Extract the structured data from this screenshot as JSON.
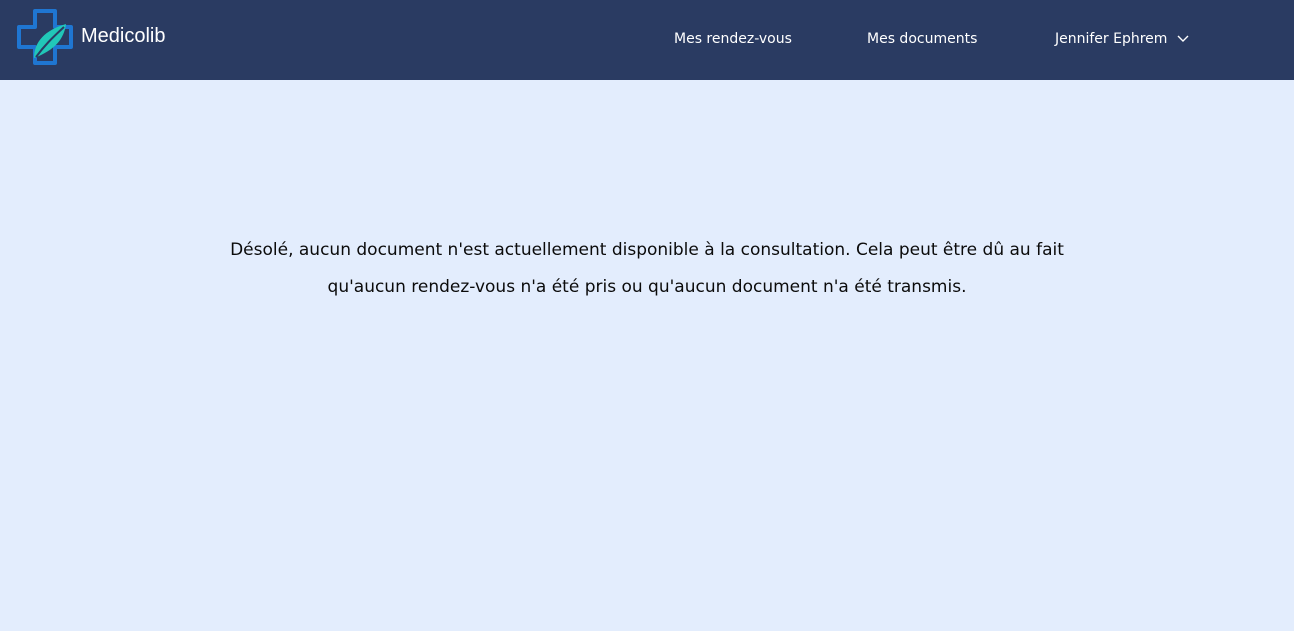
{
  "app": {
    "brand_name": "Medicolib"
  },
  "nav": {
    "appointments": "Mes rendez-vous",
    "documents": "Mes documents",
    "user_name": "Jennifer Ephrem"
  },
  "main": {
    "empty_message": "Désolé, aucun document n'est actuellement disponible à la consultation. Cela peut être dû au fait qu'aucun rendez-vous n'a été pris ou qu'aucun document n'a été transmis."
  },
  "colors": {
    "navbar_bg": "#2a3b62",
    "page_bg": "#e3edfd",
    "logo_blue": "#1f76d2",
    "logo_teal": "#21c7b8",
    "text_dark": "#0b0b0b"
  },
  "icons": {
    "logo": "medical-cross-leaf-icon",
    "user_menu": "chevron-down-icon"
  }
}
